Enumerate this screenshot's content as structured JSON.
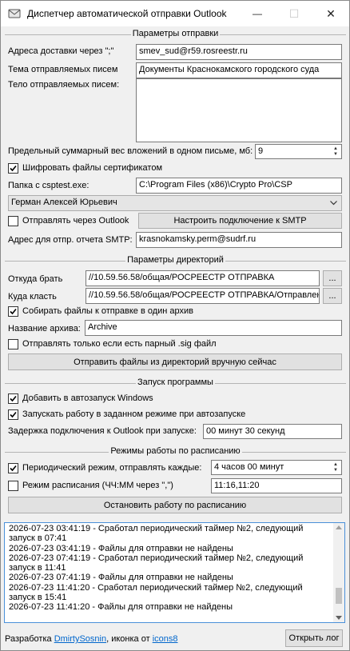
{
  "window": {
    "title": "Диспетчер автоматической отправки Outlook",
    "minimize_glyph": "—",
    "maximize_glyph": "☐",
    "close_glyph": "✕",
    "app_icon": "mail-envelope-icon"
  },
  "send_params": {
    "group_title": "Параметры отправки",
    "addresses_label": "Адреса доставки через \";\"",
    "addresses_value": "smev_sud@r59.rosreestr.ru",
    "subject_label": "Тема отправляемых писем",
    "subject_value": "Документы Краснокамского городского суда",
    "body_label": "Тело отправляемых писем:",
    "body_value": "",
    "max_size_label": "Предельный суммарный вес вложений в одном письме, мб:",
    "max_size_value": "9",
    "encrypt_label": "Шифровать файлы сертификатом",
    "encrypt_checked": true,
    "csptest_label": "Папка с csptest.exe:",
    "csptest_value": "C:\\Program Files (x86)\\Crypto Pro\\CSP",
    "certificate_value": "Герман Алексей Юрьевич",
    "via_outlook_label": "Отправлять через Outlook",
    "via_outlook_checked": false,
    "smtp_button": "Настроить подключение к SMTP",
    "report_addr_label": "Адрес для отпр. отчета SMTP:",
    "report_addr_value": "krasnokamsky.perm@sudrf.ru"
  },
  "dir_params": {
    "group_title": "Параметры директорий",
    "from_label": "Откуда брать",
    "from_value": "//10.59.56.58/общая/РОСРЕЕСТР ОТПРАВКА",
    "to_label": "Куда класть",
    "to_value": "//10.59.56.58/общая/РОСРЕЕСТР ОТПРАВКА/Отправлено",
    "browse_label": "...",
    "archive_label": "Собирать файлы к отправке в один архив",
    "archive_checked": true,
    "archive_name_label": "Название архива:",
    "archive_name_value": "Archive",
    "sig_only_label": "Отправлять только если есть парный .sig файл",
    "sig_only_checked": false,
    "send_now_button": "Отправить файлы из директорий вручную сейчас"
  },
  "startup": {
    "group_title": "Запуск программы",
    "autostart_label": "Добавить в автозапуск Windows",
    "autostart_checked": true,
    "run_mode_label": "Запускать работу в заданном режиме при автозапуске",
    "run_mode_checked": true,
    "delay_label": "Задержка подключения к Outlook при запуске:",
    "delay_value": "00 минут 30 секунд"
  },
  "schedule": {
    "group_title": "Режимы работы по расписанию",
    "periodic_label": "Периодический режим, отправлять каждые:",
    "periodic_checked": true,
    "periodic_value": "4 часов 00 минут",
    "sched_label": "Режим расписания (ЧЧ:ММ через \",\")",
    "sched_checked": false,
    "sched_value": "11:16,11:20",
    "stop_button": "Остановить работу по расписанию"
  },
  "log": {
    "lines": [
      "2026-07-23 03:41:19 - Сработал периодический таймер №2, следующий",
      "запуск в 07:41",
      "2026-07-23 03:41:19 - Файлы для отправки не найдены",
      "2026-07-23 07:41:19 - Сработал периодический таймер №2, следующий",
      "запуск в 11:41",
      "2026-07-23 07:41:19 - Файлы для отправки не найдены",
      "2026-07-23 11:41:20 - Сработал периодический таймер №2, следующий",
      "запуск в 15:41",
      "2026-07-23 11:41:20 - Файлы для отправки не найдены"
    ],
    "scrollbar_position": 0.85
  },
  "footer": {
    "dev_prefix": "Разработка ",
    "dev_link": "DmirtySosnin",
    "icons_prefix": ", иконка от ",
    "icons_link": "icons8",
    "open_log_button": "Открыть лог"
  }
}
